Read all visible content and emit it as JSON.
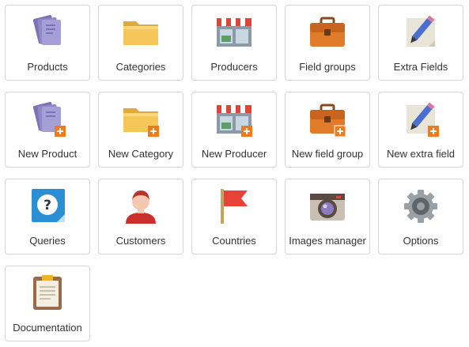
{
  "tiles": [
    {
      "label": "Products",
      "icon": "products-icon"
    },
    {
      "label": "Categories",
      "icon": "folder-icon"
    },
    {
      "label": "Producers",
      "icon": "store-icon"
    },
    {
      "label": "Field groups",
      "icon": "briefcase-icon"
    },
    {
      "label": "Extra Fields",
      "icon": "pencil-note-icon"
    },
    {
      "label": "New Product",
      "icon": "products-add-icon"
    },
    {
      "label": "New Category",
      "icon": "folder-add-icon"
    },
    {
      "label": "New Producer",
      "icon": "store-add-icon"
    },
    {
      "label": "New field group",
      "icon": "briefcase-add-icon"
    },
    {
      "label": "New extra field",
      "icon": "pencil-note-add-icon"
    },
    {
      "label": "Queries",
      "icon": "question-icon"
    },
    {
      "label": "Customers",
      "icon": "customer-icon"
    },
    {
      "label": "Countries",
      "icon": "flag-icon"
    },
    {
      "label": "Images manager",
      "icon": "camera-icon"
    },
    {
      "label": "Options",
      "icon": "gear-icon"
    },
    {
      "label": "Documentation",
      "icon": "clipboard-icon"
    }
  ]
}
